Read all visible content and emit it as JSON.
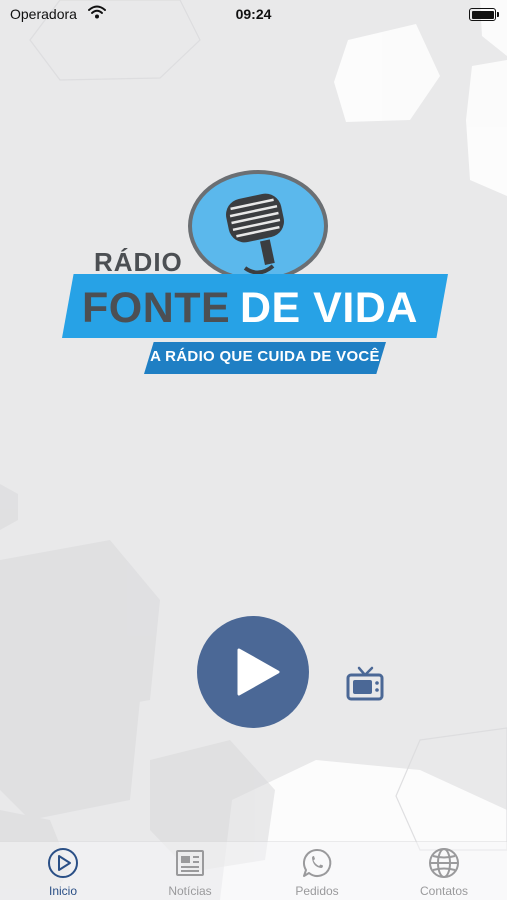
{
  "status_bar": {
    "carrier": "Operadora",
    "time": "09:24",
    "battery_level": 1.0
  },
  "logo": {
    "line1": "RÁDIO",
    "line2_part1": "FONTE",
    "line2_part2": "DE VIDA",
    "tagline": "A RÁDIO QUE CUIDA DE VOCÊ"
  },
  "player": {
    "play_icon": "play-icon",
    "tv_icon": "tv-icon",
    "accent_color": "#4b6896"
  },
  "tab_bar": {
    "active_index": 0,
    "active_color": "#2a4f86",
    "inactive_color": "#9a9a9c",
    "items": [
      {
        "label": "Inicio",
        "icon": "play-circle-icon"
      },
      {
        "label": "Notícias",
        "icon": "newspaper-icon"
      },
      {
        "label": "Pedidos",
        "icon": "whatsapp-icon"
      },
      {
        "label": "Contatos",
        "icon": "globe-icon"
      }
    ]
  }
}
